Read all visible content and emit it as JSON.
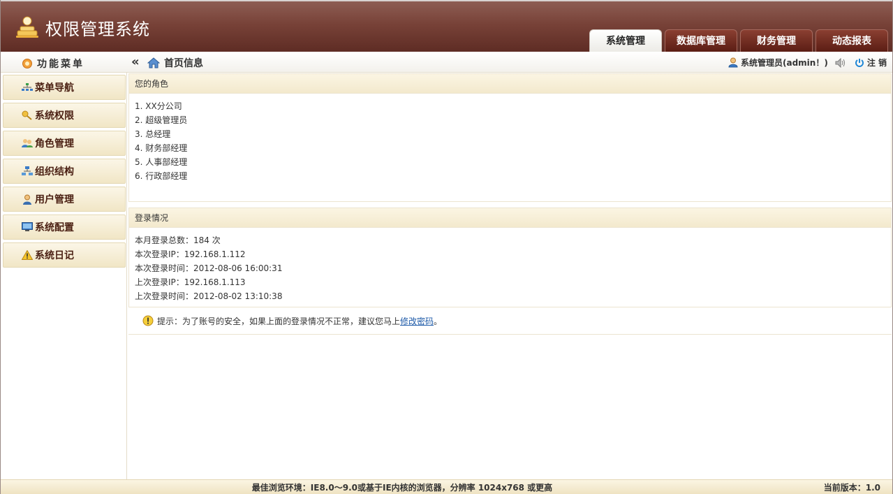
{
  "app": {
    "title": "权限管理系统"
  },
  "top_tabs": [
    {
      "label": "系统管理",
      "active": true
    },
    {
      "label": "数据库管理",
      "active": false
    },
    {
      "label": "财务管理",
      "active": false
    },
    {
      "label": "动态报表",
      "active": false
    }
  ],
  "subbar": {
    "menu_title": "功能菜单",
    "breadcrumb": "首页信息",
    "user_label": "系统管理员(admin！)",
    "logout_label": "注 销"
  },
  "sidebar": {
    "items": [
      {
        "label": "菜单导航",
        "icon": "sitemap-icon"
      },
      {
        "label": "系统权限",
        "icon": "key-icon"
      },
      {
        "label": "角色管理",
        "icon": "users-icon"
      },
      {
        "label": "组织结构",
        "icon": "org-chart-icon"
      },
      {
        "label": "用户管理",
        "icon": "user-icon"
      },
      {
        "label": "系统配置",
        "icon": "monitor-icon"
      },
      {
        "label": "系统日记",
        "icon": "warning-icon"
      }
    ]
  },
  "roles_panel": {
    "title": "您的角色",
    "items": [
      "1. XX分公司",
      "2. 超级管理员",
      "3. 总经理",
      "4. 财务部经理",
      "5. 人事部经理",
      "6. 行政部经理"
    ]
  },
  "login_panel": {
    "title": "登录情况",
    "lines": [
      "本月登录总数：184 次",
      "本次登录IP：192.168.1.112",
      "本次登录时间：2012-08-06 16:00:31",
      "上次登录IP：192.168.1.113",
      "上次登录时间：2012-08-02 13:10:38"
    ]
  },
  "tip": {
    "text": "提示：为了账号的安全，如果上面的登录情况不正常，建议您马上 ",
    "link": "修改密码",
    "suffix": "。"
  },
  "footer": {
    "env": "最佳浏览环境：IE8.0～9.0或基于IE内核的浏览器，分辨率 1024x768 或更高",
    "version": "当前版本：1.0"
  },
  "colors": {
    "header_top": "#8d5d53",
    "header_bottom": "#5e2c24",
    "tab_bg": "#6e2a1f",
    "sidebar_bg": "#f1e6c6",
    "link": "#1e5aa8"
  }
}
